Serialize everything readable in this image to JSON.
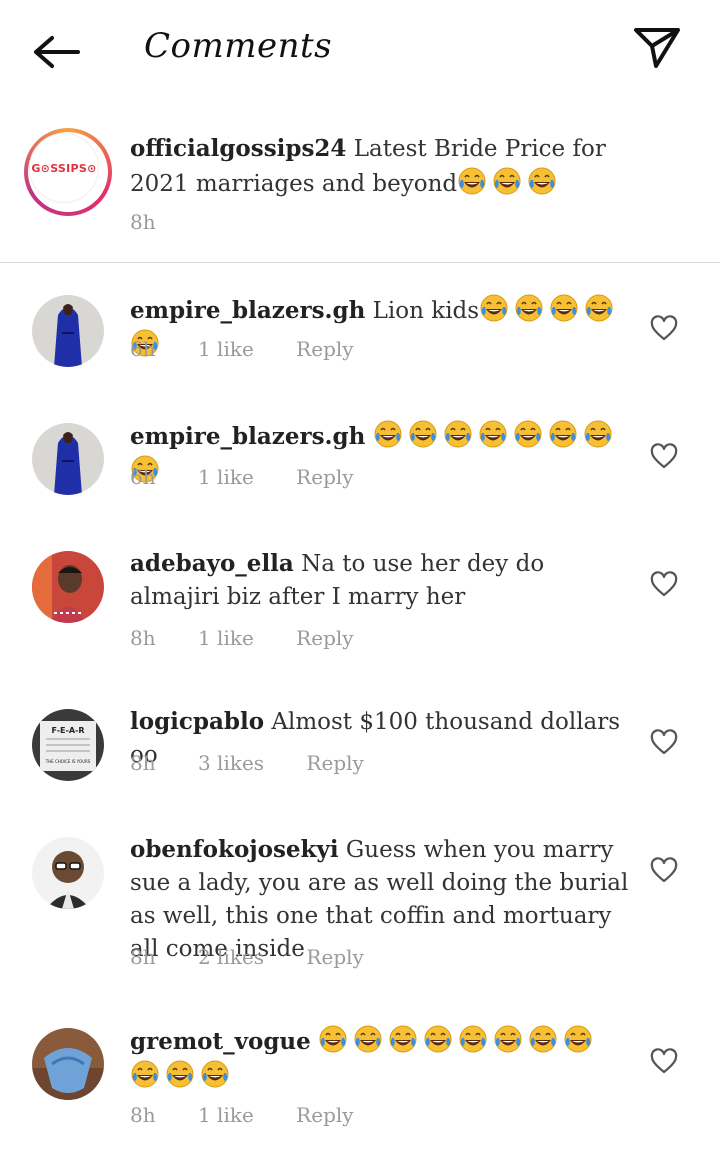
{
  "header": {
    "title": "Comments",
    "back_icon": "back-arrow-icon",
    "send_icon": "paper-plane-icon"
  },
  "caption": {
    "username": "officialgossips24",
    "text": "Latest Bride Price for 2021 marriages and beyond",
    "emoji_count": 3,
    "time": "8h",
    "avatar_logo": "G⊙SSIPS⊙"
  },
  "comments": [
    {
      "username": "empire_blazers.gh",
      "text": "Lion kids",
      "emoji_count": 5,
      "time": "6h",
      "likes": "1 like",
      "reply": "Reply"
    },
    {
      "username": "empire_blazers.gh",
      "text": "",
      "emoji_count": 8,
      "time": "6h",
      "likes": "1 like",
      "reply": "Reply"
    },
    {
      "username": "adebayo_ella",
      "text": "Na to use her dey do almajiri biz after I marry her",
      "emoji_count": 0,
      "time": "8h",
      "likes": "1 like",
      "reply": "Reply"
    },
    {
      "username": "logicpablo",
      "text": "Almost $100 thousand dollars oo",
      "emoji_count": 0,
      "time": "8h",
      "likes": "3 likes",
      "reply": "Reply",
      "avatar_sign": [
        "F-E-A-R",
        "THE CHOICE IS YOURS"
      ]
    },
    {
      "username": "obenfokojosekyi",
      "text": "Guess when you marry sue a lady, you are as well doing the burial as well, this one that  coffin and mortuary all come inside",
      "emoji_count": 0,
      "time": "8h",
      "likes": "2 likes",
      "reply": "Reply"
    },
    {
      "username": "gremot_vogue",
      "text": "",
      "emoji_count": 11,
      "time": "8h",
      "likes": "1 like",
      "reply": "Reply"
    }
  ],
  "colors": {
    "text": "#262626",
    "meta": "#9a9a9a",
    "divider": "#dbdbdb",
    "story_ring": "#e1306c",
    "emoji": "#f7c034",
    "tears": "#3b8ee0"
  }
}
